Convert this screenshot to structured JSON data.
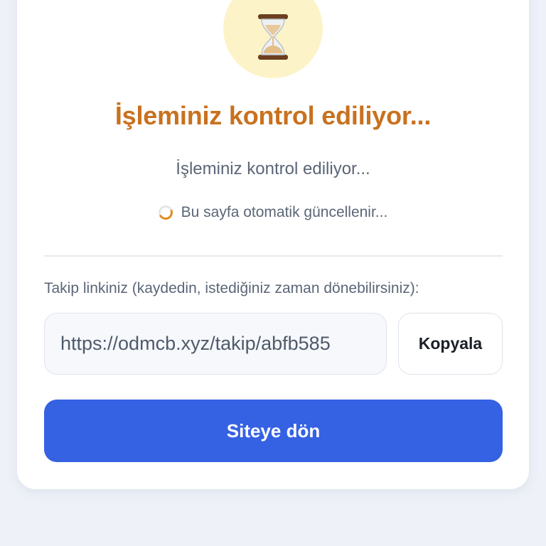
{
  "status": {
    "icon": "hourglass-icon",
    "title": "İşleminiz kontrol ediliyor...",
    "message": "İşleminiz kontrol ediliyor...",
    "auto_update_text": "Bu sayfa otomatik güncellenir..."
  },
  "tracking": {
    "label": "Takip linkiniz (kaydedin, istediğiniz zaman dönebilirsiniz):",
    "url": "https://odmcb.xyz/takip/abfb585",
    "copy_label": "Kopyala"
  },
  "actions": {
    "return_label": "Siteye dön"
  },
  "colors": {
    "title": "#c8711f",
    "primary_button": "#3561e3",
    "status_circle": "#fdf3c8",
    "spinner": "#e08a1e"
  }
}
